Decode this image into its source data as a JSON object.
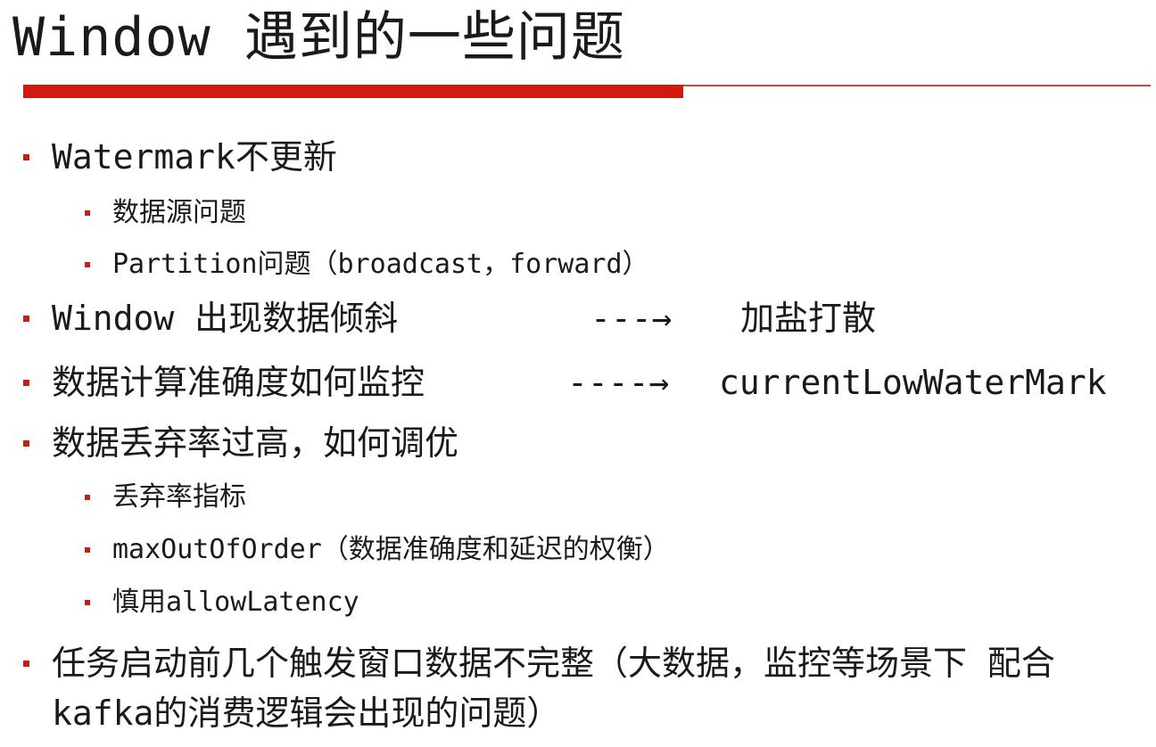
{
  "slide": {
    "title": "Window 遇到的一些问题",
    "colors": {
      "accent": "#d01a10",
      "text": "#1a1a1a",
      "background": "#ffffff"
    },
    "bullets": [
      {
        "text": "Watermark不更新",
        "children": [
          {
            "text": "数据源问题"
          },
          {
            "text": "Partition问题（broadcast，forward）"
          }
        ]
      },
      {
        "text": "Window 出现数据倾斜",
        "arrow": "---→",
        "result": "加盐打散"
      },
      {
        "text": "数据计算准确度如何监控",
        "arrow": "----→",
        "result": "currentLowWaterMark"
      },
      {
        "text": "数据丢弃率过高，如何调优",
        "children": [
          {
            "text": "丢弃率指标"
          },
          {
            "text": "maxOutOfOrder（数据准确度和延迟的权衡）"
          },
          {
            "text": "慎用allowLatency"
          }
        ]
      },
      {
        "text": "任务启动前几个触发窗口数据不完整（大数据，监控等场景下 配合kafka的消费逻辑会出现的问题）"
      }
    ]
  }
}
